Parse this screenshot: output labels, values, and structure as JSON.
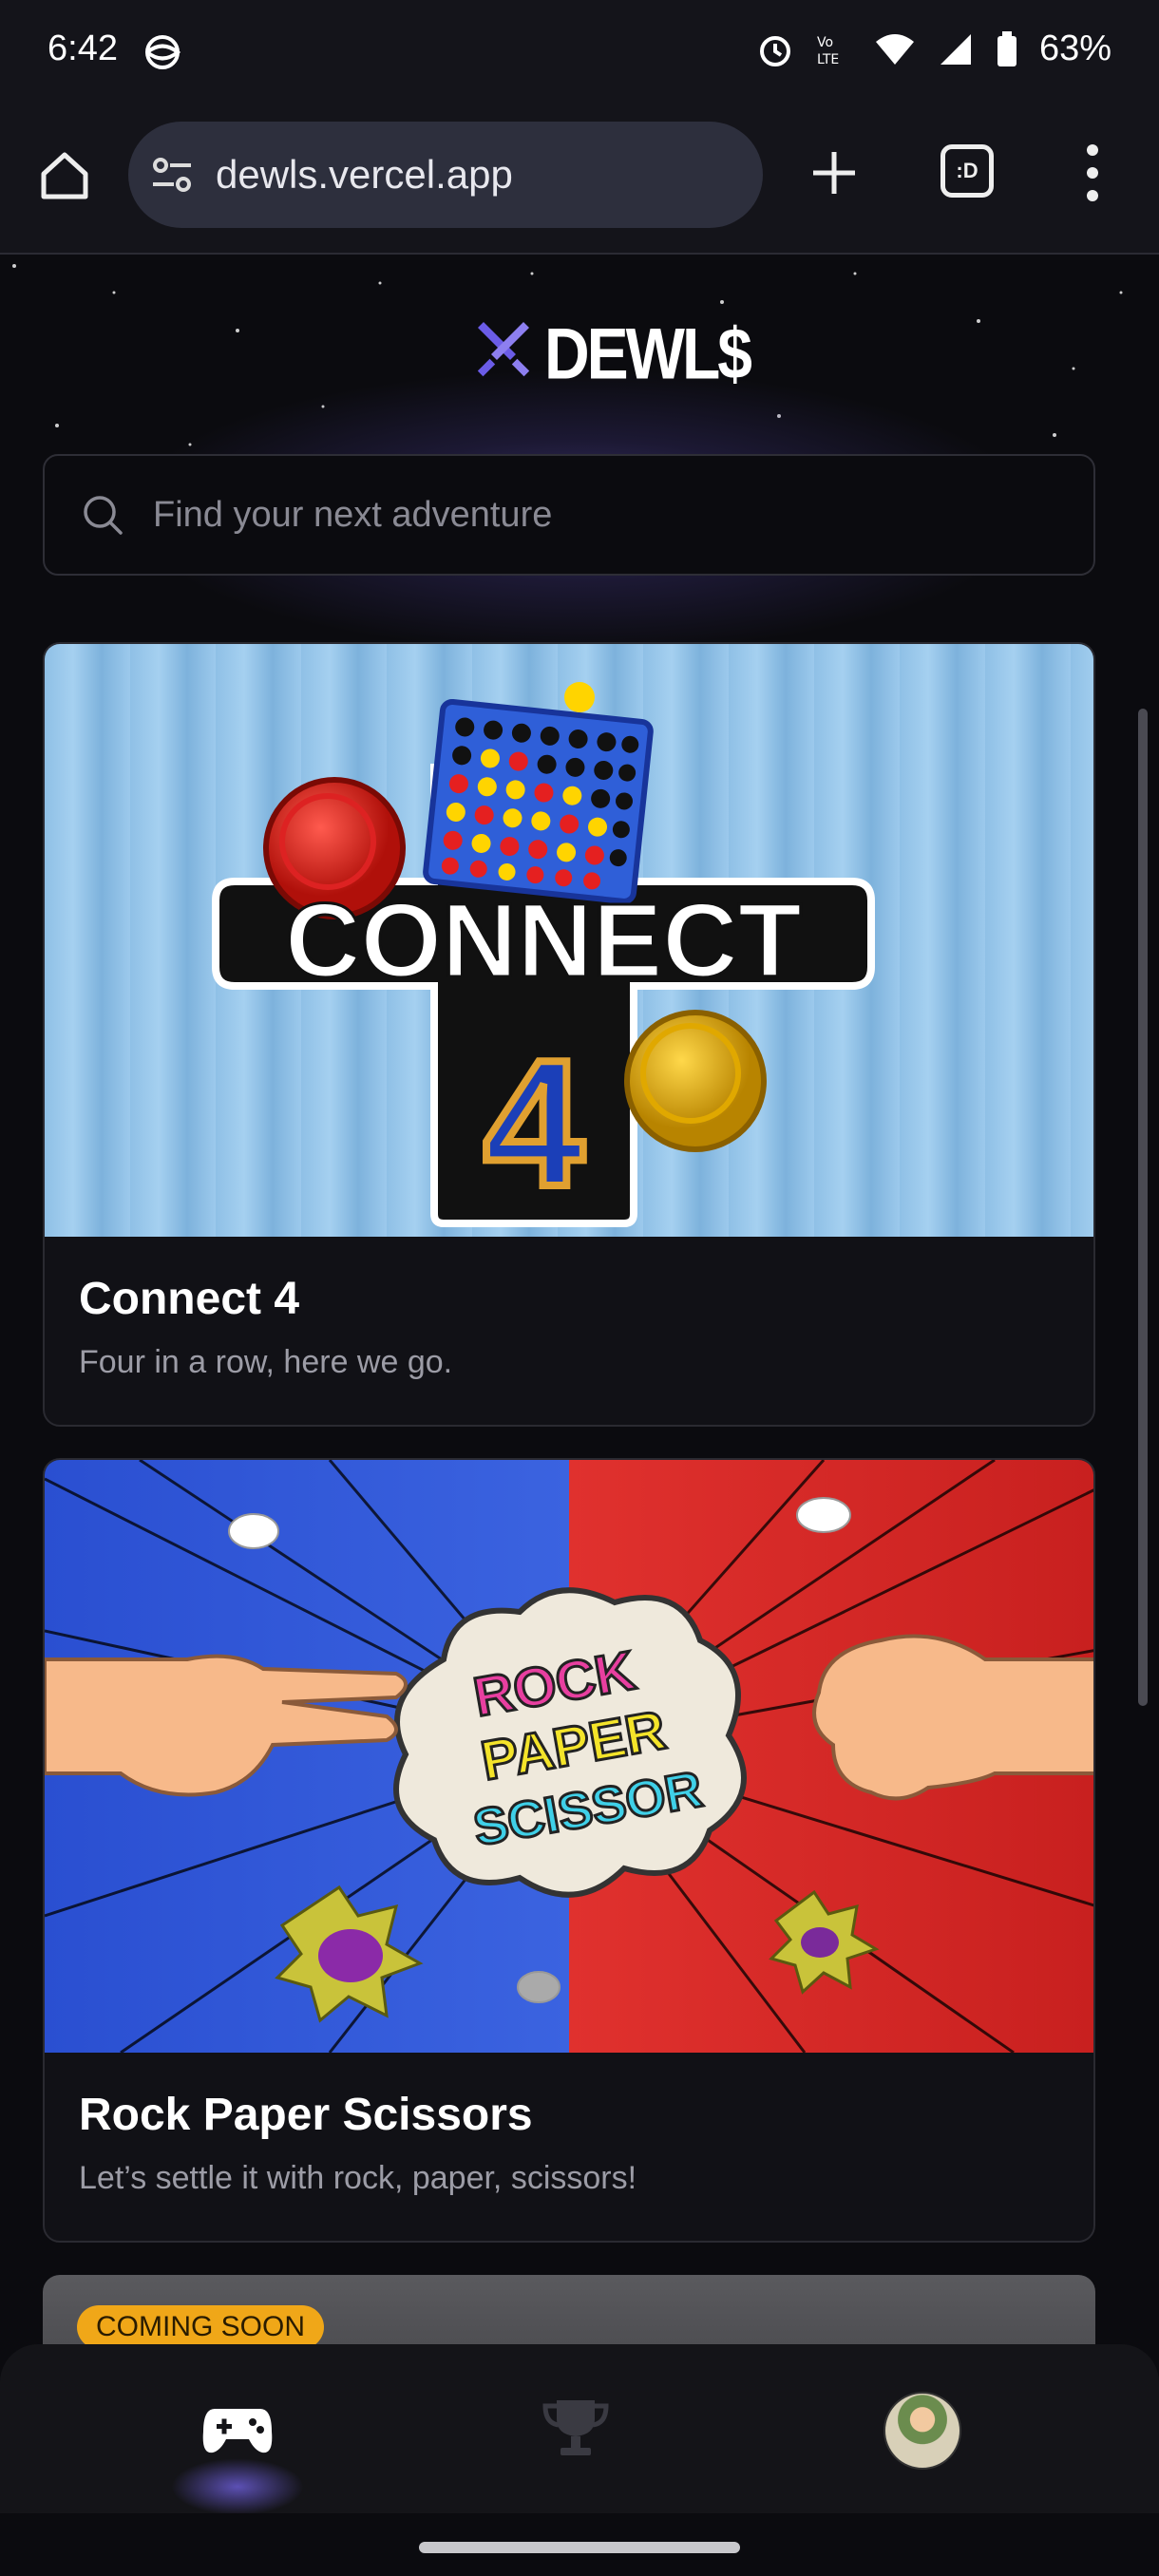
{
  "status_bar": {
    "time": "6:42",
    "battery": "63%"
  },
  "browser": {
    "url": "dewls.vercel.app",
    "tabs_label": ":D"
  },
  "logo": {
    "text": "DEWL$"
  },
  "search": {
    "placeholder": "Find your next adventure"
  },
  "games": [
    {
      "title": "Connect 4",
      "description": "Four in a row, here we go.",
      "art": {
        "title": "CONNECT",
        "number": "4"
      }
    },
    {
      "title": "Rock Paper Scissors",
      "description": "Let’s settle it with rock, paper, scissors!",
      "art": {
        "line1": "ROCK",
        "line2": "PAPER",
        "line3": "SCISSOR"
      }
    }
  ],
  "coming_soon": {
    "badge": "COMING SOON"
  },
  "bottom_nav": {
    "items": [
      "games-icon",
      "trophy-icon",
      "avatar"
    ]
  },
  "colors": {
    "accent": "#6b5ce7",
    "badge": "#f0a718",
    "background": "#0b0b0f"
  }
}
